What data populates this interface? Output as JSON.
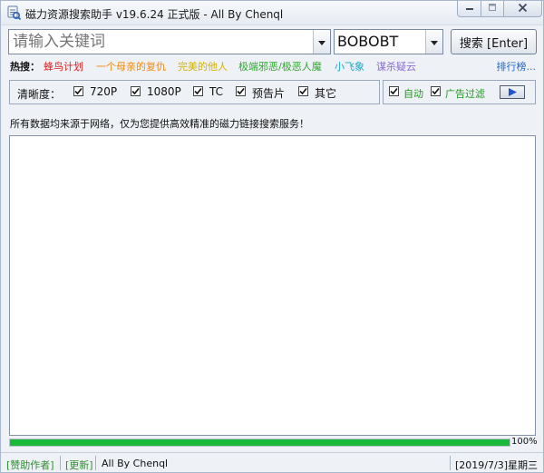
{
  "window": {
    "title": "磁力资源搜索助手 v19.6.24 正式版 - All By Chenql"
  },
  "search": {
    "placeholder": "请输入关键词",
    "engine": "BOBOBT",
    "button_label": "搜索 [Enter]"
  },
  "hot": {
    "label": "热搜：",
    "items": [
      {
        "label": "蜂鸟计划",
        "color": "#e02020"
      },
      {
        "label": "一个母亲的复仇",
        "color": "#f08a14"
      },
      {
        "label": "完美的他人",
        "color": "#d2b400"
      },
      {
        "label": "极端邪恶/极恶人魔",
        "color": "#2fa82f"
      },
      {
        "label": "小飞象",
        "color": "#18a8c8"
      },
      {
        "label": "谋杀疑云",
        "color": "#8a6cd0"
      }
    ],
    "rank_link": "排行榜..."
  },
  "filters": {
    "label": "清晰度：",
    "options": [
      {
        "label": "720P",
        "checked": true
      },
      {
        "label": "1080P",
        "checked": true
      },
      {
        "label": "TC",
        "checked": true
      },
      {
        "label": "预告片",
        "checked": true
      },
      {
        "label": "其它",
        "checked": true
      }
    ]
  },
  "options": {
    "auto_label": "自动",
    "auto_checked": true,
    "adfilter_label": "广告过滤",
    "adfilter_checked": true,
    "accent": "#1f9a1f"
  },
  "notice": "所有数据均来源于网络，仅为您提供高效精准的磁力链接搜索服务！",
  "progress": {
    "value": 100,
    "label": "100%",
    "color": "#1cb83a"
  },
  "status": {
    "sponsor_link": "[赞助作者]",
    "update_link": "[更新]",
    "author": "All By Chenql",
    "date": "[2019/7/3]星期三"
  }
}
